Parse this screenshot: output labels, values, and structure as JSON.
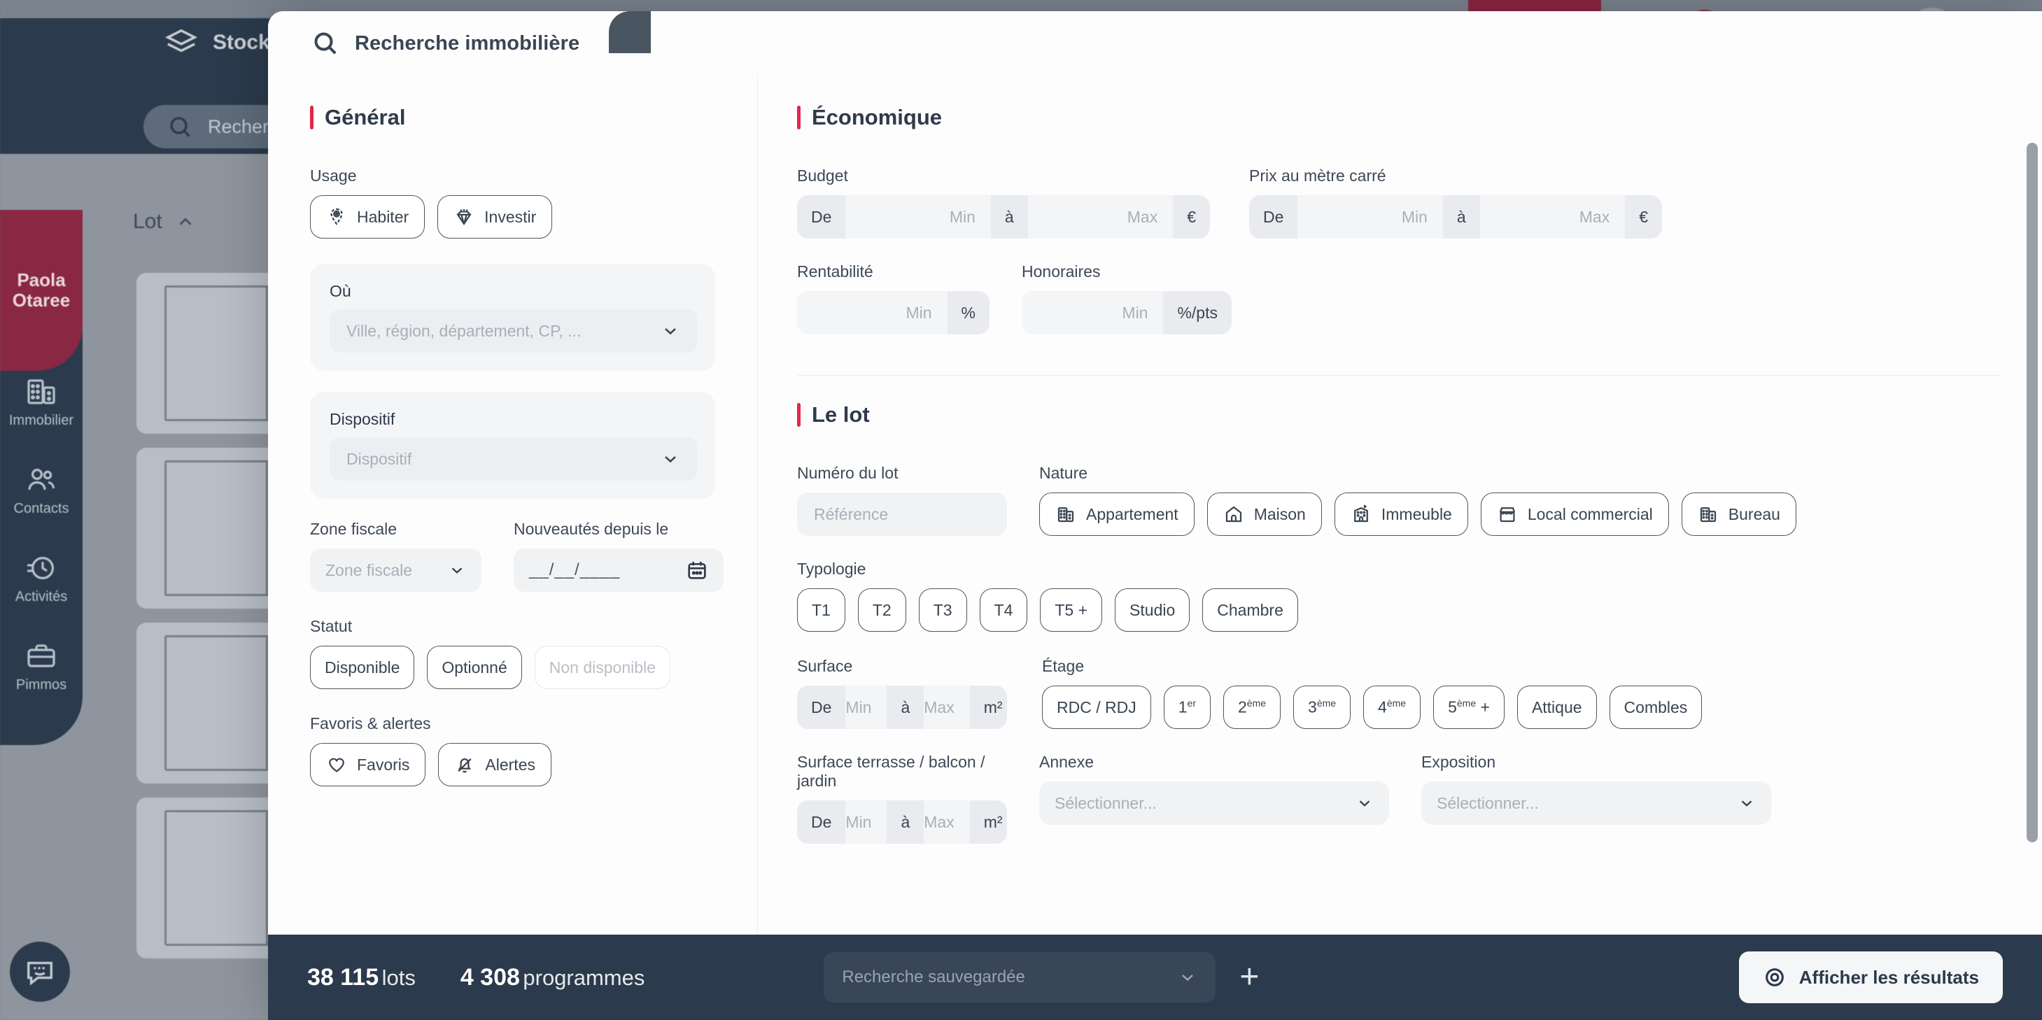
{
  "background": {
    "tab_label": "Stock",
    "search_placeholder": "Recherche",
    "column_header": "Lot",
    "user_name_line1": "Paola",
    "user_name_line2": "Otaree",
    "rail_items": [
      {
        "label": "Immobilier",
        "icon": "building-icon"
      },
      {
        "label": "Contacts",
        "icon": "users-icon"
      },
      {
        "label": "Activités",
        "icon": "clock-icon"
      },
      {
        "label": "Pimmos",
        "icon": "briefcase-icon"
      }
    ],
    "top_right_icons": [
      "users-blob-icon",
      "plus-icon",
      "hat-icon",
      "grid-icon",
      "avatar-icon",
      "chevron-down-icon"
    ]
  },
  "modal": {
    "title": "Recherche immobilière",
    "title_icon": "search-icon"
  },
  "general": {
    "section_title": "Général",
    "usage_label": "Usage",
    "usage_options": [
      {
        "label": "Habiter",
        "icon": "location-home-icon"
      },
      {
        "label": "Investir",
        "icon": "diamond-icon"
      }
    ],
    "ou_label": "Où",
    "ou_placeholder": "Ville, région, département, CP, ...",
    "dispositif_label": "Dispositif",
    "dispositif_placeholder": "Dispositif",
    "zone_fiscale_label": "Zone fiscale",
    "zone_fiscale_placeholder": "Zone fiscale",
    "nouveautes_label": "Nouveautés depuis le",
    "nouveautes_value": "__/__/____",
    "statut_label": "Statut",
    "statut_options": [
      {
        "label": "Disponible",
        "disabled": false
      },
      {
        "label": "Optionné",
        "disabled": false
      },
      {
        "label": "Non disponible",
        "disabled": true
      }
    ],
    "favoris_label": "Favoris & alertes",
    "favoris_options": [
      {
        "label": "Favoris",
        "icon": "heart-icon"
      },
      {
        "label": "Alertes",
        "icon": "bell-off-icon"
      }
    ]
  },
  "economique": {
    "section_title": "Économique",
    "budget_label": "Budget",
    "budget_range": {
      "from": "De",
      "min": "Min",
      "to": "à",
      "max": "Max",
      "unit": "€"
    },
    "prix_m2_label": "Prix au mètre carré",
    "prix_m2_range": {
      "from": "De",
      "min": "Min",
      "to": "à",
      "max": "Max",
      "unit": "€"
    },
    "rentabilite_label": "Rentabilité",
    "rentabilite_range": {
      "min": "Min",
      "unit": "%"
    },
    "honoraires_label": "Honoraires",
    "honoraires_range": {
      "min": "Min",
      "unit": "%/pts"
    }
  },
  "lot": {
    "section_title": "Le lot",
    "numero_label": "Numéro du lot",
    "numero_placeholder": "Référence",
    "nature_label": "Nature",
    "nature_options": [
      {
        "label": "Appartement",
        "icon": "apartment-icon"
      },
      {
        "label": "Maison",
        "icon": "house-icon"
      },
      {
        "label": "Immeuble",
        "icon": "building-block-icon"
      },
      {
        "label": "Local commercial",
        "icon": "shop-icon"
      },
      {
        "label": "Bureau",
        "icon": "office-icon"
      }
    ],
    "typologie_label": "Typologie",
    "typologie_options": [
      "T1",
      "T2",
      "T3",
      "T4",
      "T5 +",
      "Studio",
      "Chambre"
    ],
    "surface_label": "Surface",
    "surface_range": {
      "from": "De",
      "min": "Min",
      "to": "à",
      "max": "Max",
      "unit": "m²"
    },
    "etage_label": "Étage",
    "etage_options": [
      "RDC / RDJ",
      "1er",
      "2ème",
      "3ème",
      "4ème",
      "5ème +",
      "Attique",
      "Combles"
    ],
    "surface_terrasse_label": "Surface terrasse / balcon / jardin",
    "surface_terrasse_range": {
      "from": "De",
      "min": "Min",
      "to": "à",
      "max": "Max",
      "unit": "m²"
    },
    "annexe_label": "Annexe",
    "annexe_placeholder": "Sélectionner...",
    "exposition_label": "Exposition",
    "exposition_placeholder": "Sélectionner..."
  },
  "footer": {
    "lots_count": "38 115",
    "lots_unit": "lots",
    "programmes_count": "4 308",
    "programmes_unit": "programmes",
    "saved_search_placeholder": "Recherche sauvegardée",
    "add_icon": "plus-icon",
    "results_button": "Afficher les résultats",
    "results_icon": "target-icon"
  },
  "colors": {
    "accent_red": "#e3264f",
    "dark_navy": "#2b3a4c",
    "panel_bg": "#fdfdfd",
    "user_badge": "#8a2742"
  }
}
